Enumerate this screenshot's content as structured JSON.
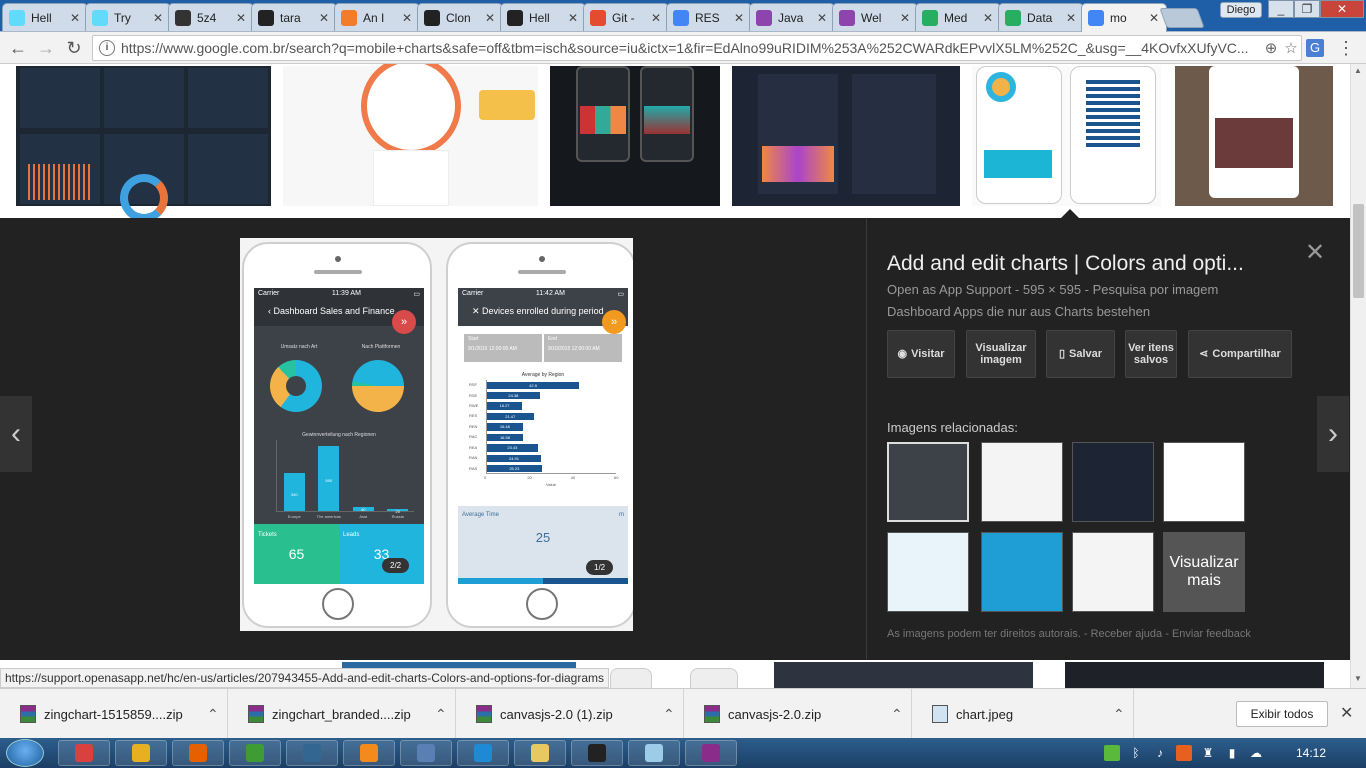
{
  "browser": {
    "tabs": [
      {
        "label": "Hell",
        "icon": "react-icon",
        "color": "#61dafb"
      },
      {
        "label": "Try",
        "icon": "react-icon",
        "color": "#61dafb"
      },
      {
        "label": "5z4",
        "icon": "cube-icon",
        "color": "#333333"
      },
      {
        "label": "tara",
        "icon": "github-icon",
        "color": "#222222"
      },
      {
        "label": "An I",
        "icon": "hackernoon-icon",
        "color": "#f27c2c"
      },
      {
        "label": "Clon",
        "icon": "github-icon",
        "color": "#222222"
      },
      {
        "label": "Hell",
        "icon": "github-icon",
        "color": "#222222"
      },
      {
        "label": "Git -",
        "icon": "git-icon",
        "color": "#e44c30"
      },
      {
        "label": "RES",
        "icon": "google-icon",
        "color": "#4285f4"
      },
      {
        "label": "Java",
        "icon": "chart-icon",
        "color": "#8e44ad"
      },
      {
        "label": "Wel",
        "icon": "chart-icon",
        "color": "#8e44ad"
      },
      {
        "label": "Med",
        "icon": "plus-icon",
        "color": "#27ae60"
      },
      {
        "label": "Data",
        "icon": "plus-icon",
        "color": "#27ae60"
      },
      {
        "label": "mo",
        "icon": "google-icon",
        "color": "#4285f4"
      }
    ],
    "user": "Diego",
    "url": "https://www.google.com.br/search?q=mobile+charts&safe=off&tbm=isch&source=iu&ictx=1&fir=EdAlno99uRIDIM%253A%252CWARdkEPvvlX5LM%252C_&usg=__4KOvfxXUfyVC..."
  },
  "preview": {
    "title": "Add and edit charts | Colors and opti...",
    "meta": "Open as App Support - 595 × 595 - Pesquisa por imagem",
    "desc": "Dashboard Apps die nur aus Charts bestehen",
    "buttons": {
      "visit": "Visitar",
      "view_image": "Visualizar imagem",
      "save": "Salvar",
      "saved": "Ver itens salvos",
      "share": "Compartilhar"
    },
    "related_label": "Imagens relacionadas:",
    "see_more": "Visualizar mais",
    "footer": {
      "copyright": "As imagens podem ter direitos autorais.",
      "help": "Receber ajuda",
      "feedback": "Enviar feedback"
    },
    "phone1": {
      "carrier": "Carrier",
      "time": "11:39 AM",
      "title": "Dashboard Sales and Finance",
      "pie1": "Umsatz nach Art",
      "pie2": "Nach Plattformen",
      "bar_title": "Gewinnverteilung nach Regionen",
      "bars": [
        {
          "label": "Europe",
          "value": 340
        },
        {
          "label": "The americas",
          "value": 590
        },
        {
          "label": "Asia",
          "value": 40
        },
        {
          "label": "Russia",
          "value": 20
        }
      ],
      "ticket_label": "Tickets",
      "ticket_value": "65",
      "leads_label": "Leads",
      "leads_value": "33",
      "badge": "2/2"
    },
    "phone2": {
      "carrier": "Carrier",
      "time": "11:42 AM",
      "title": "Devices enrolled during period",
      "start_label": "Start",
      "start_value": "9/1/2015 12:00:00 AM",
      "end_label": "End",
      "end_value": "9/10/2015 12:00:00 AM",
      "chart_title": "Average by Region",
      "bars": [
        {
          "label": "RSF",
          "value": 42.5
        },
        {
          "label": "RSE",
          "value": 24.38
        },
        {
          "label": "RWE",
          "value": 16.27
        },
        {
          "label": "RES",
          "value": 21.47
        },
        {
          "label": "REN",
          "value": 16.48
        },
        {
          "label": "RAC",
          "value": 16.58
        },
        {
          "label": "REA",
          "value": 23.43
        },
        {
          "label": "RAN",
          "value": 24.91
        },
        {
          "label": "RAS",
          "value": 25.23
        }
      ],
      "x_ticks": [
        "0",
        "20",
        "40",
        "60"
      ],
      "x_label": "Value",
      "avg_label": "Average Time",
      "avg_unit": "m",
      "avg_value": "25",
      "badge": "1/2"
    }
  },
  "status_link": "https://support.openasapp.net/hc/en-us/articles/207943455-Add-and-edit-charts-Colors-and-options-for-diagrams",
  "downloads": {
    "items": [
      {
        "name": "zingchart-1515859....zip"
      },
      {
        "name": "zingchart_branded....zip"
      },
      {
        "name": "canvasjs-2.0 (1).zip"
      },
      {
        "name": "canvasjs-2.0.zip"
      },
      {
        "name": "chart.jpeg"
      }
    ],
    "show_all": "Exibir todos"
  },
  "taskbar": {
    "clock": "14:12",
    "apps": [
      {
        "icon": "paint-icon",
        "color": "#d94040"
      },
      {
        "icon": "chrome-icon",
        "color": "#e8b020"
      },
      {
        "icon": "firefox-icon",
        "color": "#e66000"
      },
      {
        "icon": "ie-icon",
        "color": "#3f9c35"
      },
      {
        "icon": "postgres-icon",
        "color": "#336791"
      },
      {
        "icon": "sublime-icon",
        "color": "#f38a1c"
      },
      {
        "icon": "virtualbox-icon",
        "color": "#5a7fb5"
      },
      {
        "icon": "vscode-icon",
        "color": "#1e8ad6"
      },
      {
        "icon": "explorer-icon",
        "color": "#e8c860"
      },
      {
        "icon": "terminal-icon",
        "color": "#222222"
      },
      {
        "icon": "notepad-icon",
        "color": "#9ccce8"
      },
      {
        "icon": "winrar-icon",
        "color": "#8a2c8a"
      }
    ]
  }
}
